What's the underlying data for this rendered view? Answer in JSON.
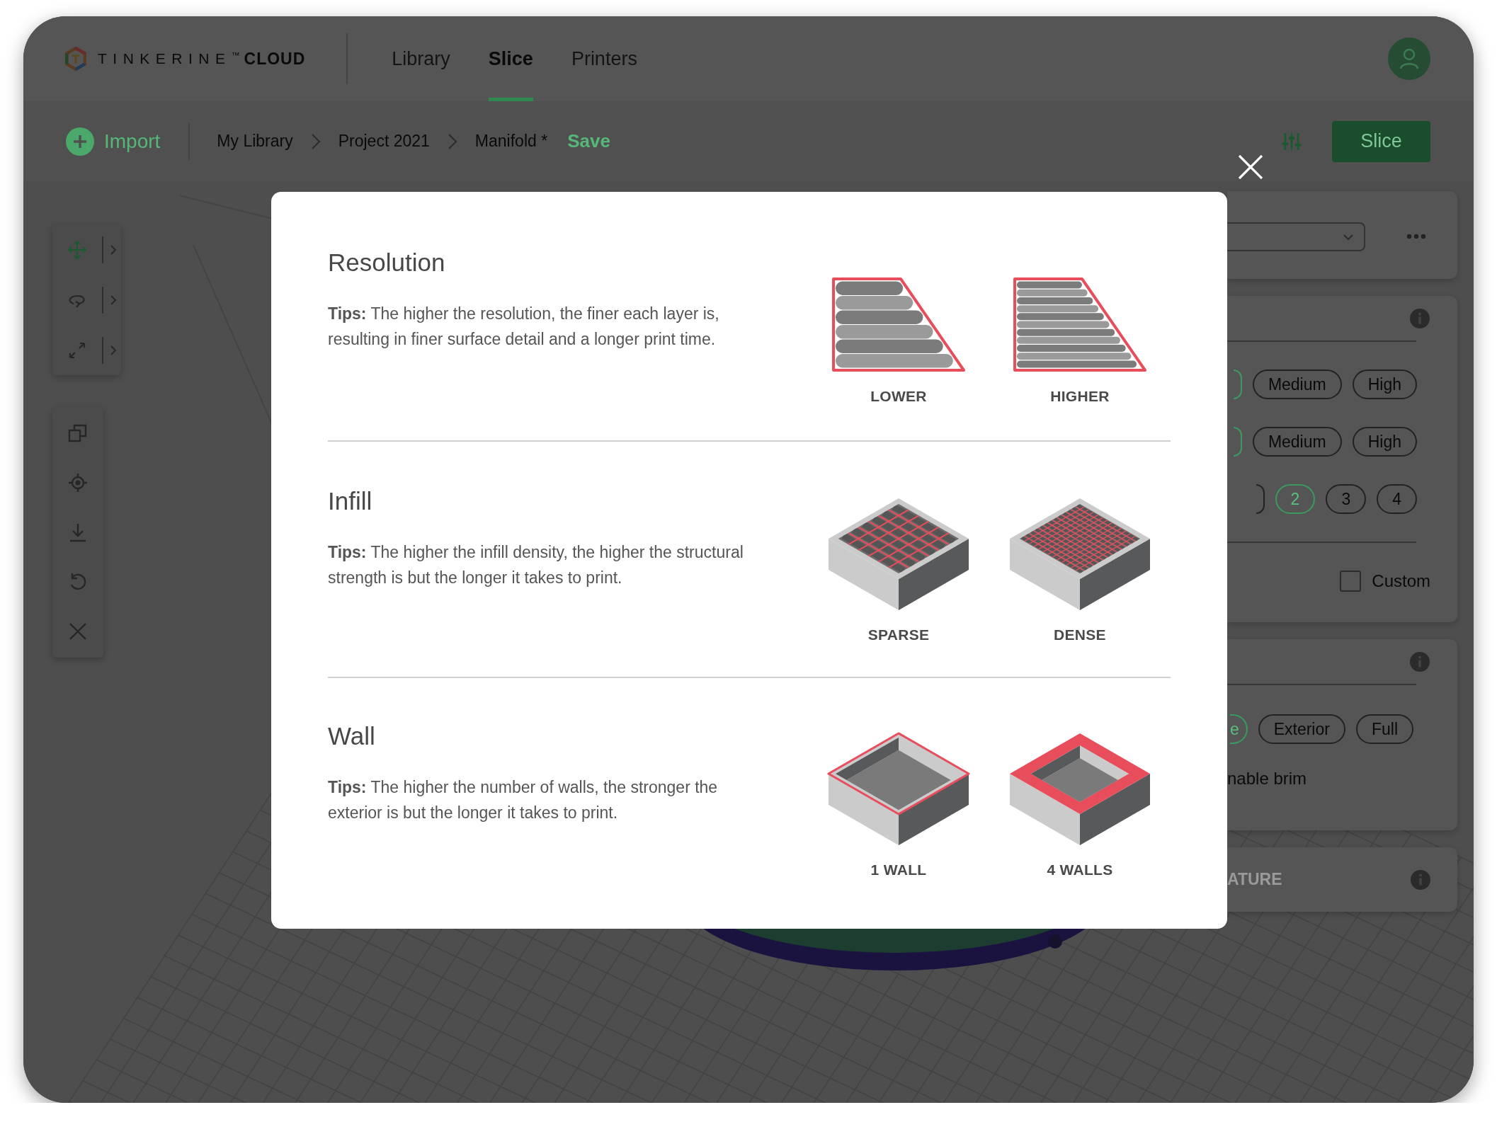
{
  "header": {
    "brand": "TINKERINE$^{™}$",
    "brand_suffix": "CLOUD",
    "tabs": [
      {
        "label": "Library",
        "selected": false
      },
      {
        "label": "Slice",
        "selected": true
      },
      {
        "label": "Printers",
        "selected": false
      }
    ]
  },
  "toolbar": {
    "import_label": "Import",
    "breadcrumbs": [
      {
        "label": "My Library"
      },
      {
        "label": "Project 2021"
      },
      {
        "label": "Manifold *"
      }
    ],
    "save_label": "Save",
    "slice_label": "Slice"
  },
  "transform_tools": [
    {
      "selected": true
    },
    {
      "selected": false
    },
    {
      "selected": false
    }
  ],
  "settings": {
    "quality_rows": [
      [
        {
          "selected": true
        },
        {
          "label": "Medium",
          "selected": false
        },
        {
          "label": "High",
          "selected": false
        }
      ],
      [
        {
          "selected": true
        },
        {
          "label": "Medium",
          "selected": false
        },
        {
          "label": "High",
          "selected": false
        }
      ],
      [
        {
          "selected": false
        },
        {
          "label": "2",
          "selected": true
        },
        {
          "label": "3",
          "selected": false
        },
        {
          "label": "4",
          "selected": false
        }
      ]
    ],
    "custom": {
      "label": "Custom",
      "checked": false
    },
    "support_options": [
      {
        "label": "e",
        "selected": true
      },
      {
        "label": "Exterior",
        "selected": false
      },
      {
        "label": "Full",
        "selected": false
      }
    ],
    "brim_text": "nable brim",
    "temperature_heading": "ATURE"
  },
  "dialog": {
    "sections": [
      {
        "title": "Resolution",
        "tip": "**Tips:** The higher the resolution, the finer each layer is, resulting in finer surface detail and a longer print time.",
        "figures": [
          {
            "kind": "layers-coarse",
            "label": "LOWER"
          },
          {
            "kind": "layers-fine",
            "label": "HIGHER"
          }
        ]
      },
      {
        "title": "Infill",
        "tip": "**Tips:** The higher the infill density, the higher the structural strength is but the longer it takes to print.",
        "figures": [
          {
            "kind": "infill-sparse",
            "label": "SPARSE"
          },
          {
            "kind": "infill-dense",
            "label": "DENSE"
          }
        ]
      },
      {
        "title": "Wall",
        "tip": "**Tips:** The higher the number of walls, the stronger the exterior is but the longer it takes to print.",
        "figures": [
          {
            "kind": "wall-thin",
            "label": "1 WALL"
          },
          {
            "kind": "wall-thick",
            "label": "4 WALLS"
          }
        ]
      }
    ]
  }
}
